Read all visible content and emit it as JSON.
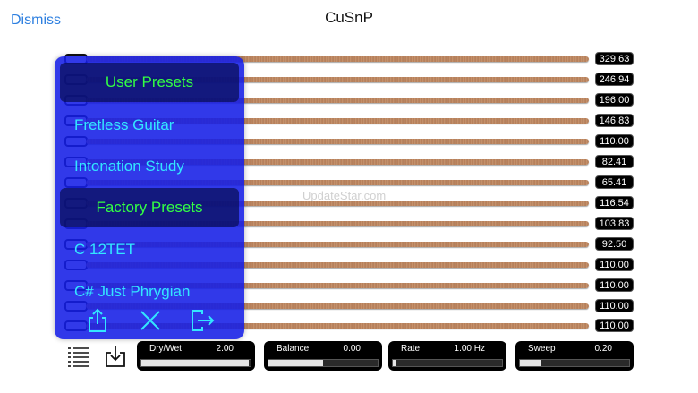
{
  "header": {
    "dismiss_label": "Dismiss",
    "title": "CuSnP"
  },
  "strings": {
    "frequencies": [
      "329.63",
      "246.94",
      "196.00",
      "146.83",
      "110.00",
      "82.41",
      "65.41",
      "116.54",
      "103.83",
      "92.50",
      "110.00",
      "110.00",
      "110.00",
      "110.00"
    ]
  },
  "watermark": "UpdateStar.com",
  "presets_panel": {
    "user_header": "User Presets",
    "user_items": [
      "Fretless Guitar",
      "Intonation Study"
    ],
    "factory_header": "Factory Presets",
    "factory_items": [
      "C 12TET",
      "C# Just Phrygian"
    ],
    "icons": [
      "share-icon",
      "close-icon",
      "export-icon"
    ]
  },
  "bottom_bar": {
    "icons": [
      "list-icon",
      "download-icon"
    ],
    "controls": [
      {
        "label": "Dry/Wet",
        "value": "2.00",
        "level": 0.98
      },
      {
        "label": "Balance",
        "value": "0.00",
        "level": 0.5
      },
      {
        "label": "Rate",
        "value": "1.00 Hz",
        "level": 0.03
      },
      {
        "label": "Sweep",
        "value": "0.20",
        "level": 0.2
      }
    ]
  }
}
